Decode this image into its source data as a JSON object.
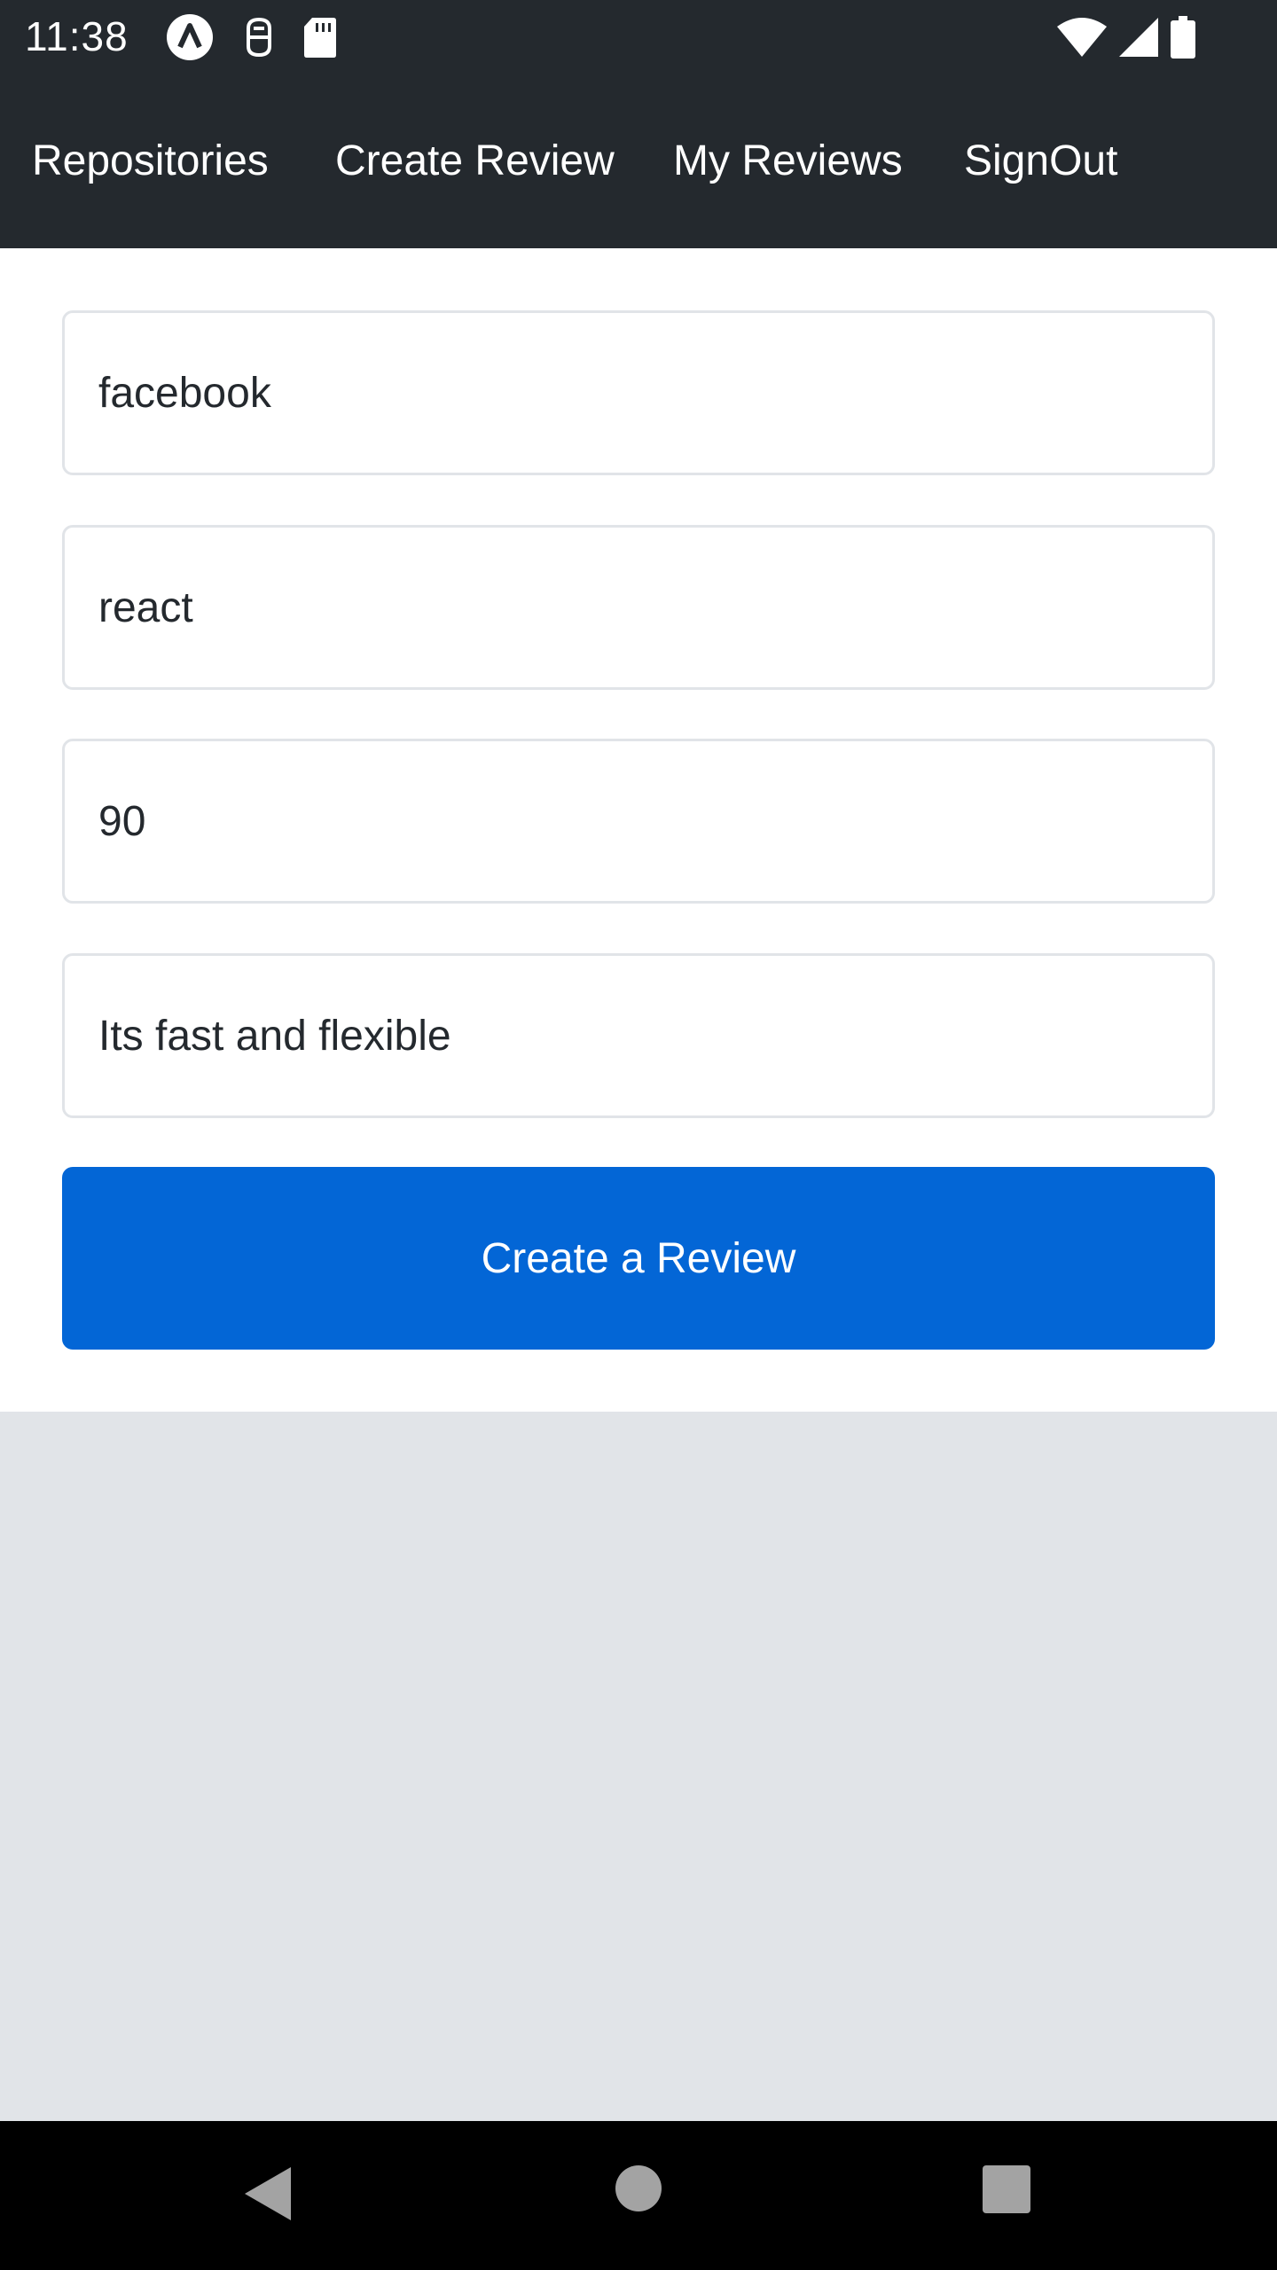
{
  "status_bar": {
    "time": "11:38",
    "icons_left": [
      "app-notification-icon",
      "debug-icon",
      "sd-card-icon"
    ],
    "icons_right": [
      "wifi-icon",
      "signal-icon",
      "battery-icon"
    ]
  },
  "nav": {
    "items": [
      {
        "label": "Repositories"
      },
      {
        "label": "Create Review"
      },
      {
        "label": "My Reviews"
      },
      {
        "label": "SignOut"
      }
    ]
  },
  "form": {
    "owner": {
      "value": "facebook"
    },
    "repository": {
      "value": "react"
    },
    "rating": {
      "value": "90"
    },
    "review": {
      "value": "Its fast and flexible"
    },
    "submit_label": "Create a Review"
  },
  "colors": {
    "header_bg": "#24292e",
    "primary": "#0366d6",
    "page_bg": "#e1e4e8",
    "panel_bg": "#ffffff"
  },
  "system_nav": {
    "buttons": [
      "back-icon",
      "home-icon",
      "recents-icon"
    ]
  }
}
